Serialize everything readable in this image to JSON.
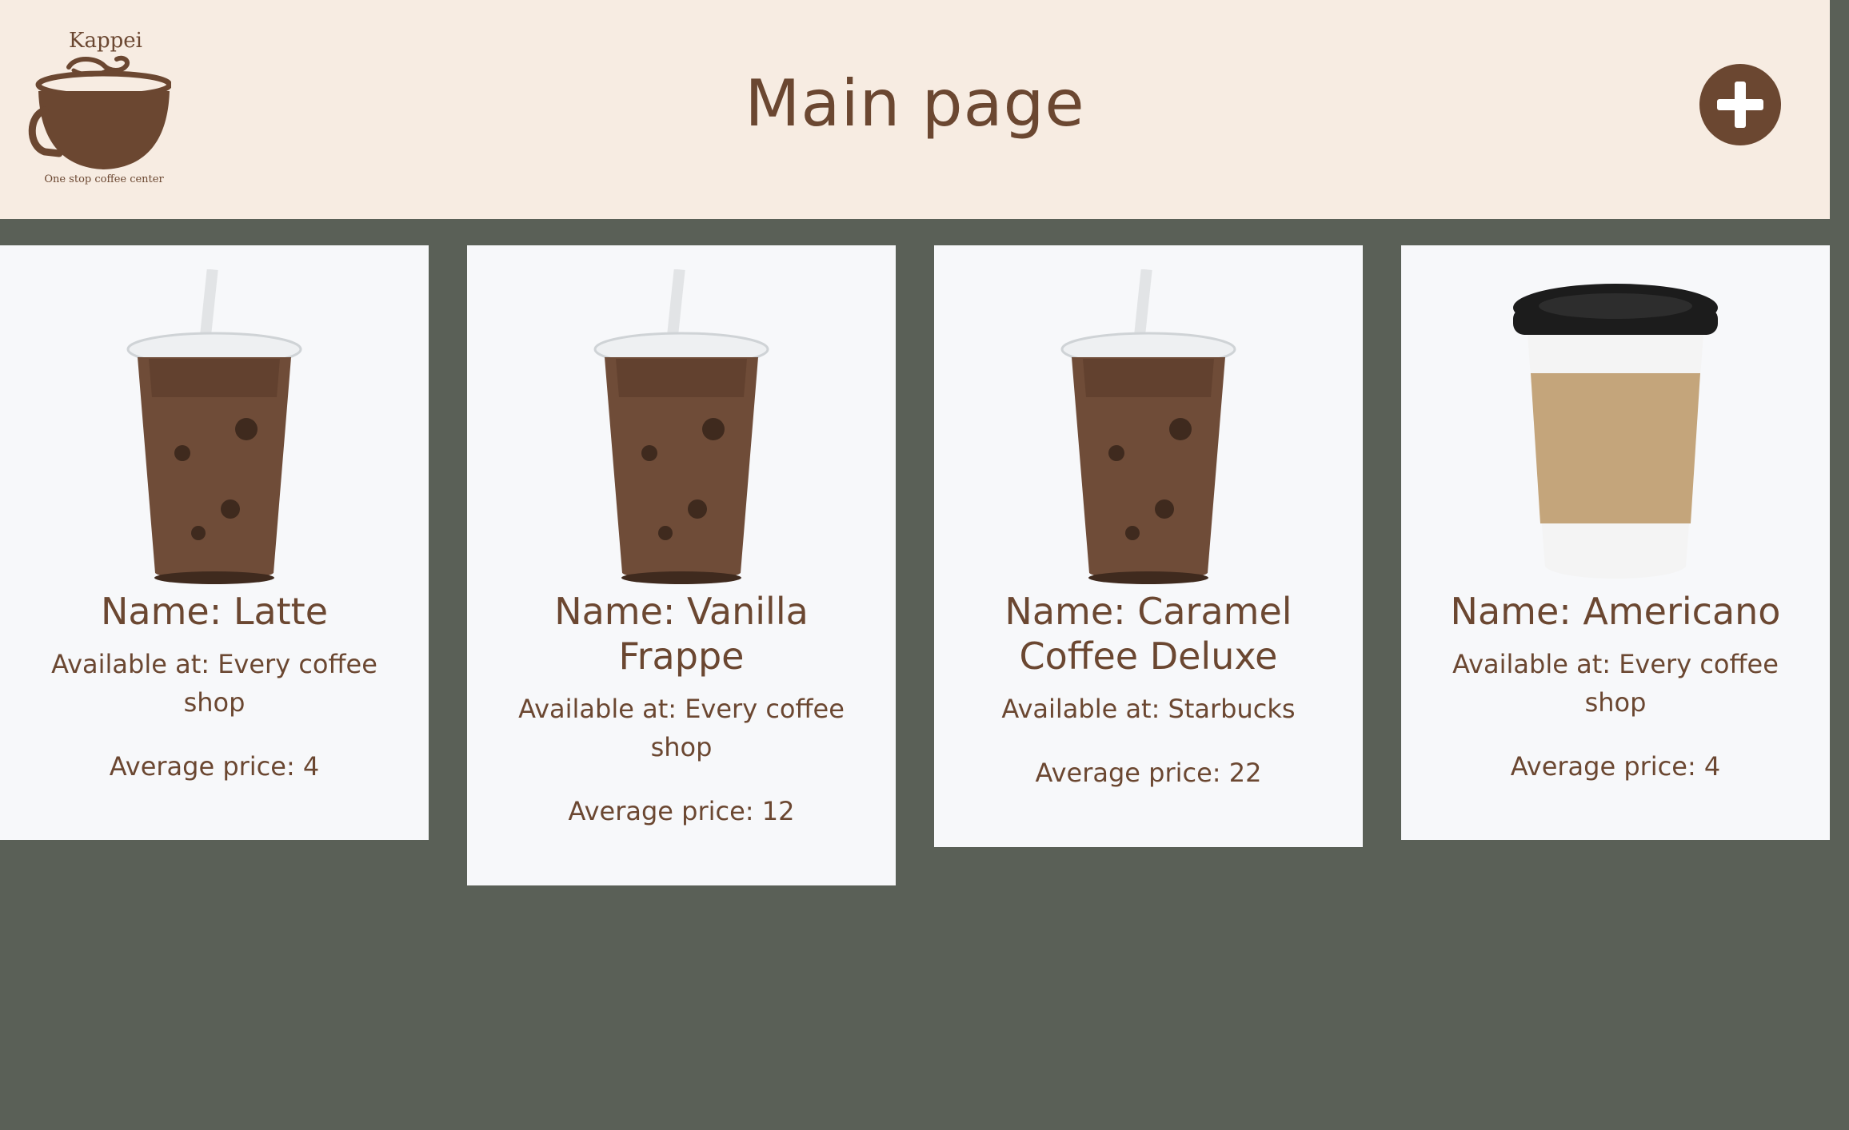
{
  "header": {
    "title": "Main page",
    "logo": {
      "brand_name": "Kappei",
      "tagline": "One stop coffee center"
    },
    "add_button_icon": "plus-icon"
  },
  "colors": {
    "header_bg": "#f7ece2",
    "page_bg": "#5a6057",
    "card_bg": "#f7f8fa",
    "brown_accent": "#6b4731"
  },
  "products": [
    {
      "name": "Name: Latte",
      "availability": "Available at: Every coffee shop",
      "price": "Average price: 4",
      "image_icon": "iced-coffee-cup-icon"
    },
    {
      "name": "Name: Vanilla Frappe",
      "availability": "Available at: Every coffee shop",
      "price": "Average price: 12",
      "image_icon": "iced-coffee-cup-icon"
    },
    {
      "name": "Name: Caramel Coffee Deluxe",
      "availability": "Available at: Starbucks",
      "price": "Average price: 22",
      "image_icon": "iced-coffee-cup-icon"
    },
    {
      "name": "Name: Americano",
      "availability": "Available at: Every coffee shop",
      "price": "Average price: 4",
      "image_icon": "hot-coffee-cup-icon"
    }
  ]
}
